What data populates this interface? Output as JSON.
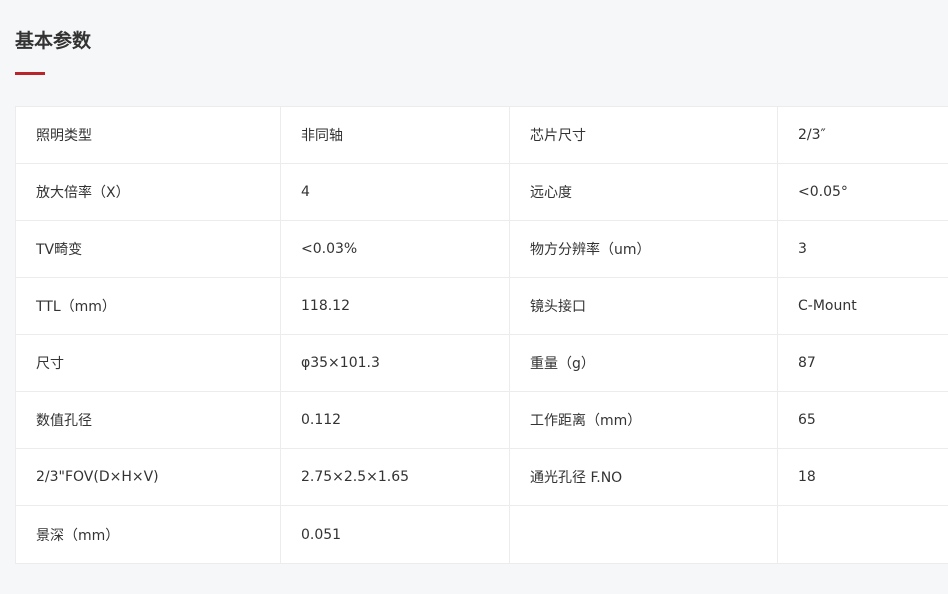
{
  "section": {
    "title": "基本参数"
  },
  "rows": [
    {
      "k1": "照明类型",
      "v1": "非同轴",
      "k2": "芯片尺寸",
      "v2": "2/3″"
    },
    {
      "k1": "放大倍率（X）",
      "v1": "4",
      "k2": "远心度",
      "v2": "<0.05°"
    },
    {
      "k1": "TV畸变",
      "v1": "<0.03%",
      "k2": "物方分辨率（um）",
      "v2": "3"
    },
    {
      "k1": "TTL（mm）",
      "v1": "118.12",
      "k2": "镜头接口",
      "v2": "C-Mount"
    },
    {
      "k1": "尺寸",
      "v1": "φ35×101.3",
      "k2": "重量（g）",
      "v2": "87"
    },
    {
      "k1": "数值孔径",
      "v1": "0.112",
      "k2": "工作距离（mm）",
      "v2": "65"
    },
    {
      "k1": "2/3\"FOV(D×H×V)",
      "v1": "2.75×2.5×1.65",
      "k2": "通光孔径 F.NO",
      "v2": "18"
    },
    {
      "k1": "景深（mm）",
      "v1": "0.051",
      "k2": "",
      "v2": ""
    }
  ],
  "colors": {
    "accent": "#b8262b",
    "background": "#f6f7f9",
    "table_background": "#ffffff",
    "border": "#ececec",
    "text": "#333333"
  }
}
